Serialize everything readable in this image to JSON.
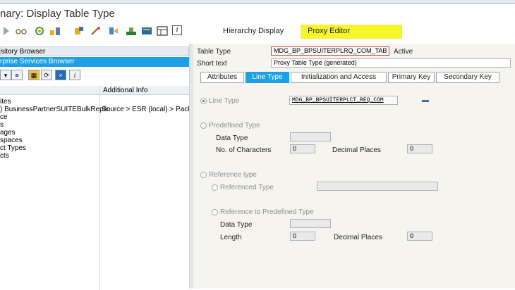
{
  "window": {
    "title": "nary: Display Table Type"
  },
  "toolbar": {
    "hierarchy_display": "Hierarchy Display",
    "proxy_editor": "Proxy Editor",
    "info_icon": "i"
  },
  "left": {
    "repository": "sitory Browser",
    "esb": "rprise Services Browser",
    "columns": {
      "name": "",
      "additional_info": "Additional Info"
    },
    "tree": [
      {
        "label": "ites",
        "info": ""
      },
      {
        "label": ") BusinessPartnerSUITEBulkReplic",
        "info": "Source > ESR (local) > Pack"
      },
      {
        "label": "ce",
        "info": ""
      },
      {
        "label": "s",
        "info": ""
      },
      {
        "label": "ages",
        "info": ""
      },
      {
        "label": "spaces",
        "info": ""
      },
      {
        "label": "ct Types",
        "info": ""
      },
      {
        "label": "cts",
        "info": ""
      }
    ],
    "tool_info_icon": "i"
  },
  "right": {
    "table_type_label": "Table Type",
    "table_type_value": "MDG_BP_BPSUITERPLRQ_COM_TAB",
    "status": "Active",
    "short_text_label": "Short text",
    "short_text_value": "Proxy Table Type (generated)",
    "tabs": [
      "Attributes",
      "Line Type",
      "Initialization and Access",
      "Primary Key",
      "Secondary Key"
    ],
    "line_type_label": "Line Type",
    "line_type_value": "MDG_BP_BPSUITERPLCT_REQ_COM",
    "predefined_type": "Predefined Type",
    "data_type": "Data Type",
    "no_of_characters": "No. of Characters",
    "no_of_characters_value": "0",
    "decimal_places": "Decimal Places",
    "decimal_places_value": "0",
    "reference_type": "Reference type",
    "referenced_type": "Referenced Type",
    "reference_to_predefined": "Reference to Predefined Type",
    "data_type2": "Data Type",
    "length": "Length",
    "length_value": "0",
    "decimal_places2": "Decimal Places",
    "decimal_places2_value": "0"
  },
  "colors": {
    "accent": "#1ea0e6",
    "highlight": "#f5f52a"
  }
}
